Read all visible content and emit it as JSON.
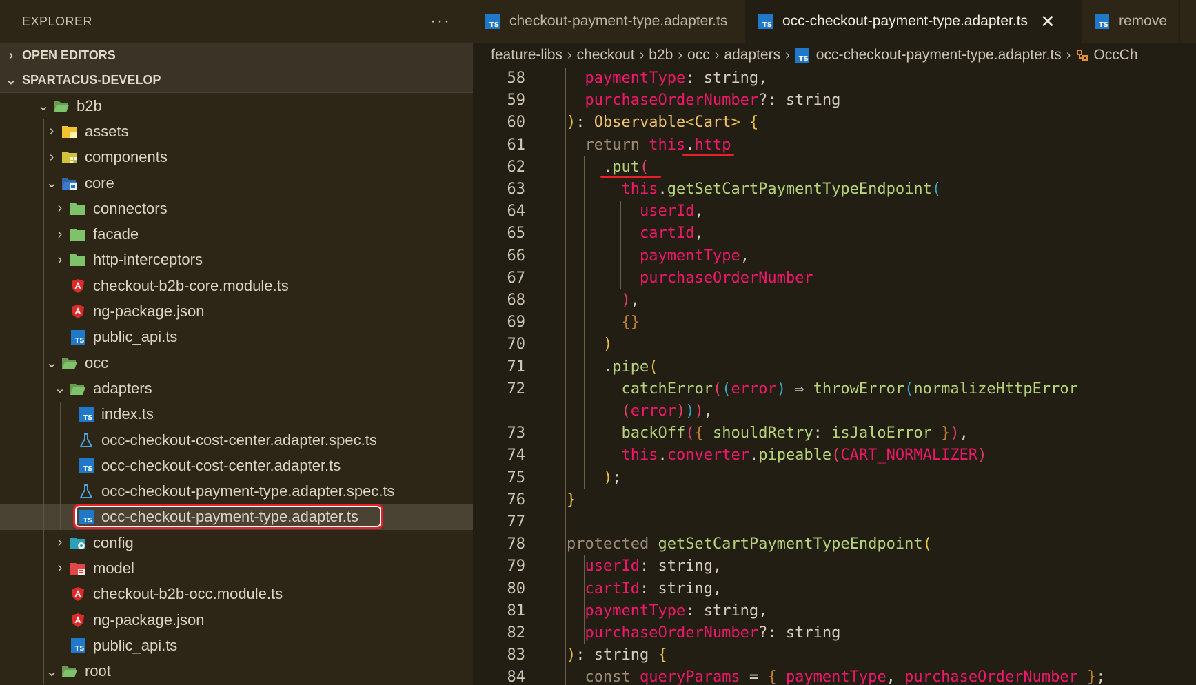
{
  "sidebar": {
    "title": "EXPLORER",
    "more": "···",
    "open_editors": "OPEN EDITORS",
    "workspace": "SPARTACUS-DEVELOP",
    "tree": [
      {
        "label": "b2b",
        "depth": 0,
        "chevron": "open",
        "icon": "folder-open-green"
      },
      {
        "label": "assets",
        "depth": 1,
        "chevron": "closed",
        "icon": "folder-yellow"
      },
      {
        "label": "components",
        "depth": 1,
        "chevron": "closed",
        "icon": "folder-components"
      },
      {
        "label": "core",
        "depth": 1,
        "chevron": "open",
        "icon": "folder-core"
      },
      {
        "label": "connectors",
        "depth": 2,
        "chevron": "closed",
        "icon": "folder-green"
      },
      {
        "label": "facade",
        "depth": 2,
        "chevron": "closed",
        "icon": "folder-green"
      },
      {
        "label": "http-interceptors",
        "depth": 2,
        "chevron": "closed",
        "icon": "folder-green"
      },
      {
        "label": "checkout-b2b-core.module.ts",
        "depth": 2,
        "chevron": "none",
        "icon": "angular"
      },
      {
        "label": "ng-package.json",
        "depth": 2,
        "chevron": "none",
        "icon": "angular"
      },
      {
        "label": "public_api.ts",
        "depth": 2,
        "chevron": "none",
        "icon": "ts"
      },
      {
        "label": "occ",
        "depth": 1,
        "chevron": "open",
        "icon": "folder-open-green"
      },
      {
        "label": "adapters",
        "depth": 2,
        "chevron": "open",
        "icon": "folder-open-green"
      },
      {
        "label": "index.ts",
        "depth": 3,
        "chevron": "none",
        "icon": "ts"
      },
      {
        "label": "occ-checkout-cost-center.adapter.spec.ts",
        "depth": 3,
        "chevron": "none",
        "icon": "flask"
      },
      {
        "label": "occ-checkout-cost-center.adapter.ts",
        "depth": 3,
        "chevron": "none",
        "icon": "ts"
      },
      {
        "label": "occ-checkout-payment-type.adapter.spec.ts",
        "depth": 3,
        "chevron": "none",
        "icon": "flask"
      },
      {
        "label": "occ-checkout-payment-type.adapter.ts",
        "depth": 3,
        "chevron": "none",
        "icon": "ts",
        "selected": true
      },
      {
        "label": "config",
        "depth": 2,
        "chevron": "closed",
        "icon": "folder-config"
      },
      {
        "label": "model",
        "depth": 2,
        "chevron": "closed",
        "icon": "folder-model"
      },
      {
        "label": "checkout-b2b-occ.module.ts",
        "depth": 2,
        "chevron": "none",
        "icon": "angular"
      },
      {
        "label": "ng-package.json",
        "depth": 2,
        "chevron": "none",
        "icon": "angular"
      },
      {
        "label": "public_api.ts",
        "depth": 2,
        "chevron": "none",
        "icon": "ts"
      },
      {
        "label": "root",
        "depth": 1,
        "chevron": "open",
        "icon": "folder-open-green"
      }
    ]
  },
  "tabs": [
    {
      "label": "checkout-payment-type.adapter.ts",
      "active": false
    },
    {
      "label": "occ-checkout-payment-type.adapter.ts",
      "active": true,
      "close": "✕"
    },
    {
      "label": "remove",
      "active": false
    }
  ],
  "breadcrumb": [
    "feature-libs",
    "checkout",
    "b2b",
    "occ",
    "adapters",
    "occ-checkout-payment-type.adapter.ts",
    "OccCh"
  ],
  "code_lines": [
    {
      "n": "58",
      "indent": 1,
      "tokens": [
        [
          "p",
          "paymentType"
        ],
        [
          "pu",
          ": "
        ],
        [
          "pu",
          "string,"
        ]
      ]
    },
    {
      "n": "59",
      "indent": 1,
      "tokens": [
        [
          "p",
          "purchaseOrderNumber"
        ],
        [
          "pu",
          "?: "
        ],
        [
          "pu",
          "string"
        ]
      ]
    },
    {
      "n": "60",
      "indent": 0,
      "tokens": [
        [
          "b1",
          ")"
        ],
        [
          "pu",
          ": "
        ],
        [
          "ty",
          "Observable"
        ],
        [
          "b1",
          "<"
        ],
        [
          "ty",
          "Cart"
        ],
        [
          "b1",
          ">"
        ],
        [
          "pu",
          " "
        ],
        [
          "b1",
          "{"
        ]
      ]
    },
    {
      "n": "61",
      "indent": 1,
      "tokens": [
        [
          "k",
          "return "
        ],
        [
          "th",
          "this"
        ],
        [
          "pu",
          "."
        ],
        [
          "th",
          "http"
        ]
      ]
    },
    {
      "n": "62",
      "indent": 2,
      "tokens": [
        [
          "pu",
          "."
        ],
        [
          "fn",
          "put"
        ],
        [
          "b2",
          "("
        ]
      ]
    },
    {
      "n": "63",
      "indent": 3,
      "tokens": [
        [
          "th",
          "this"
        ],
        [
          "pu",
          "."
        ],
        [
          "fn",
          "getSetCartPaymentTypeEndpoint"
        ],
        [
          "b4",
          "("
        ]
      ]
    },
    {
      "n": "64",
      "indent": 4,
      "tokens": [
        [
          "p",
          "userId"
        ],
        [
          "pu",
          ","
        ]
      ]
    },
    {
      "n": "65",
      "indent": 4,
      "tokens": [
        [
          "p",
          "cartId"
        ],
        [
          "pu",
          ","
        ]
      ]
    },
    {
      "n": "66",
      "indent": 4,
      "tokens": [
        [
          "p",
          "paymentType"
        ],
        [
          "pu",
          ","
        ]
      ]
    },
    {
      "n": "67",
      "indent": 4,
      "tokens": [
        [
          "p",
          "purchaseOrderNumber"
        ]
      ]
    },
    {
      "n": "68",
      "indent": 3,
      "tokens": [
        [
          "b2",
          ")"
        ],
        [
          "pu",
          ","
        ]
      ]
    },
    {
      "n": "69",
      "indent": 3,
      "tokens": [
        [
          "b3",
          "{}"
        ]
      ]
    },
    {
      "n": "70",
      "indent": 2,
      "tokens": [
        [
          "b1",
          ")"
        ]
      ]
    },
    {
      "n": "71",
      "indent": 2,
      "tokens": [
        [
          "pu",
          "."
        ],
        [
          "fn",
          "pipe"
        ],
        [
          "b1",
          "("
        ]
      ]
    },
    {
      "n": "72",
      "indent": 3,
      "tokens": [
        [
          "fn",
          "catchError"
        ],
        [
          "b2",
          "("
        ],
        [
          "b4",
          "("
        ],
        [
          "p",
          "error"
        ],
        [
          "b4",
          ")"
        ],
        [
          "pu",
          " "
        ],
        [
          "ar",
          "⇒"
        ],
        [
          "pu",
          " "
        ],
        [
          "fn",
          "throwError"
        ],
        [
          "b4",
          "("
        ],
        [
          "fn",
          "normalizeHttpError"
        ]
      ]
    },
    {
      "n": "",
      "indent": 3,
      "tokens": [
        [
          "b2",
          "("
        ],
        [
          "p",
          "error"
        ],
        [
          "b2",
          ")"
        ],
        [
          "b4",
          ")"
        ],
        [
          "b2",
          ")"
        ],
        [
          "pu",
          ","
        ]
      ]
    },
    {
      "n": "73",
      "indent": 3,
      "tokens": [
        [
          "fn",
          "backOff"
        ],
        [
          "b2",
          "("
        ],
        [
          "b3",
          "{ "
        ],
        [
          "fn",
          "shouldRetry"
        ],
        [
          "pu",
          ": "
        ],
        [
          "fn",
          "isJaloError"
        ],
        [
          "b3",
          " }"
        ],
        [
          "b2",
          ")"
        ],
        [
          "pu",
          ","
        ]
      ]
    },
    {
      "n": "74",
      "indent": 3,
      "tokens": [
        [
          "th",
          "this"
        ],
        [
          "pu",
          "."
        ],
        [
          "p",
          "converter"
        ],
        [
          "pu",
          "."
        ],
        [
          "fn",
          "pipeable"
        ],
        [
          "b2",
          "("
        ],
        [
          "cn",
          "CART_NORMALIZER"
        ],
        [
          "b2",
          ")"
        ]
      ]
    },
    {
      "n": "75",
      "indent": 2,
      "tokens": [
        [
          "b1",
          ")"
        ],
        [
          "pu",
          ";"
        ]
      ]
    },
    {
      "n": "76",
      "indent": 0,
      "tokens": [
        [
          "b1",
          "}"
        ]
      ]
    },
    {
      "n": "77",
      "indent": 0,
      "tokens": []
    },
    {
      "n": "78",
      "indent": 0,
      "tokens": [
        [
          "k",
          "protected "
        ],
        [
          "fn",
          "getSetCartPaymentTypeEndpoint"
        ],
        [
          "b1",
          "("
        ]
      ]
    },
    {
      "n": "79",
      "indent": 1,
      "tokens": [
        [
          "p",
          "userId"
        ],
        [
          "pu",
          ": "
        ],
        [
          "pu",
          "string,"
        ]
      ]
    },
    {
      "n": "80",
      "indent": 1,
      "tokens": [
        [
          "p",
          "cartId"
        ],
        [
          "pu",
          ": "
        ],
        [
          "pu",
          "string,"
        ]
      ]
    },
    {
      "n": "81",
      "indent": 1,
      "tokens": [
        [
          "p",
          "paymentType"
        ],
        [
          "pu",
          ": "
        ],
        [
          "pu",
          "string,"
        ]
      ]
    },
    {
      "n": "82",
      "indent": 1,
      "tokens": [
        [
          "p",
          "purchaseOrderNumber"
        ],
        [
          "pu",
          "?: "
        ],
        [
          "pu",
          "string"
        ]
      ]
    },
    {
      "n": "83",
      "indent": 0,
      "tokens": [
        [
          "b1",
          ")"
        ],
        [
          "pu",
          ": "
        ],
        [
          "pu",
          "string "
        ],
        [
          "b1",
          "{"
        ]
      ]
    },
    {
      "n": "84",
      "indent": 1,
      "tokens": [
        [
          "k",
          "const "
        ],
        [
          "p",
          "queryParams"
        ],
        [
          "pu",
          " = "
        ],
        [
          "b3",
          "{ "
        ],
        [
          "p",
          "paymentType"
        ],
        [
          "pu",
          ", "
        ],
        [
          "p",
          "purchaseOrderNumber"
        ],
        [
          "b3",
          " }"
        ],
        [
          "pu",
          ";"
        ]
      ]
    }
  ]
}
